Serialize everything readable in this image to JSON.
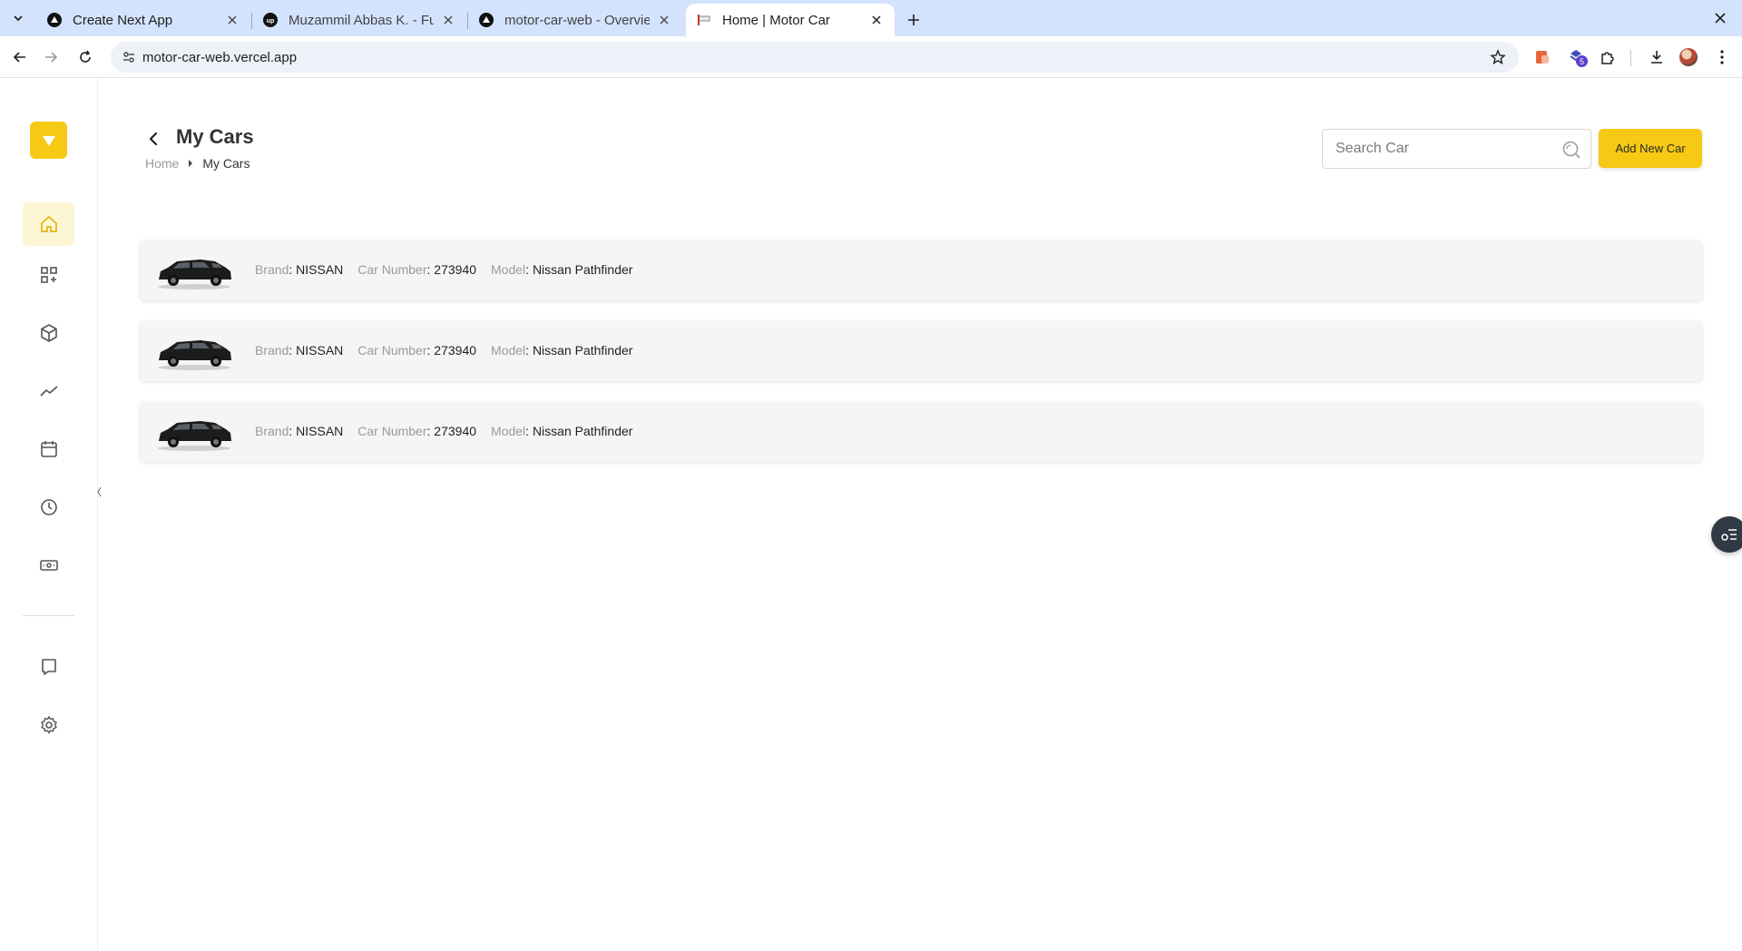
{
  "browser": {
    "tabs": [
      {
        "title": "Create Next App",
        "favicon": "vercel-triangle-icon",
        "active": false
      },
      {
        "title": "Muzammil Abbas K. - Fu",
        "favicon": "upwork-icon",
        "active": false
      },
      {
        "title": "motor-car-web - Overvie",
        "favicon": "vercel-triangle-icon",
        "active": false
      },
      {
        "title": "Home | Motor Car",
        "favicon": "motor-car-icon",
        "active": true
      }
    ],
    "url": "motor-car-web.vercel.app",
    "extension_badge": "5"
  },
  "sidebar": {
    "items": [
      {
        "icon": "home-icon",
        "active": true
      },
      {
        "icon": "grid-plus-icon",
        "active": false
      },
      {
        "icon": "package-icon",
        "active": false
      },
      {
        "icon": "trend-line-icon",
        "active": false
      },
      {
        "icon": "calendar-icon",
        "active": false
      },
      {
        "icon": "clock-icon",
        "active": false
      },
      {
        "icon": "ticket-icon",
        "active": false
      },
      {
        "icon": "chat-icon",
        "active": false
      },
      {
        "icon": "gear-icon",
        "active": false
      }
    ]
  },
  "header": {
    "title": "My Cars",
    "breadcrumb": {
      "home": "Home",
      "current": "My Cars"
    }
  },
  "search": {
    "placeholder": "Search Car",
    "value": ""
  },
  "add_button": {
    "label": "Add New Car"
  },
  "field_labels": {
    "brand": "Brand",
    "car_number": "Car Number",
    "model": "Model"
  },
  "cars": [
    {
      "brand": "NISSAN",
      "car_number": "273940",
      "model": "Nissan Pathfinder"
    },
    {
      "brand": "NISSAN",
      "car_number": "273940",
      "model": "Nissan Pathfinder"
    },
    {
      "brand": "NISSAN",
      "car_number": "273940",
      "model": "Nissan Pathfinder"
    }
  ],
  "colors": {
    "accent": "#f6c915",
    "active_nav_bg": "#fdf6d4",
    "card_bg": "#f5f5f5"
  }
}
